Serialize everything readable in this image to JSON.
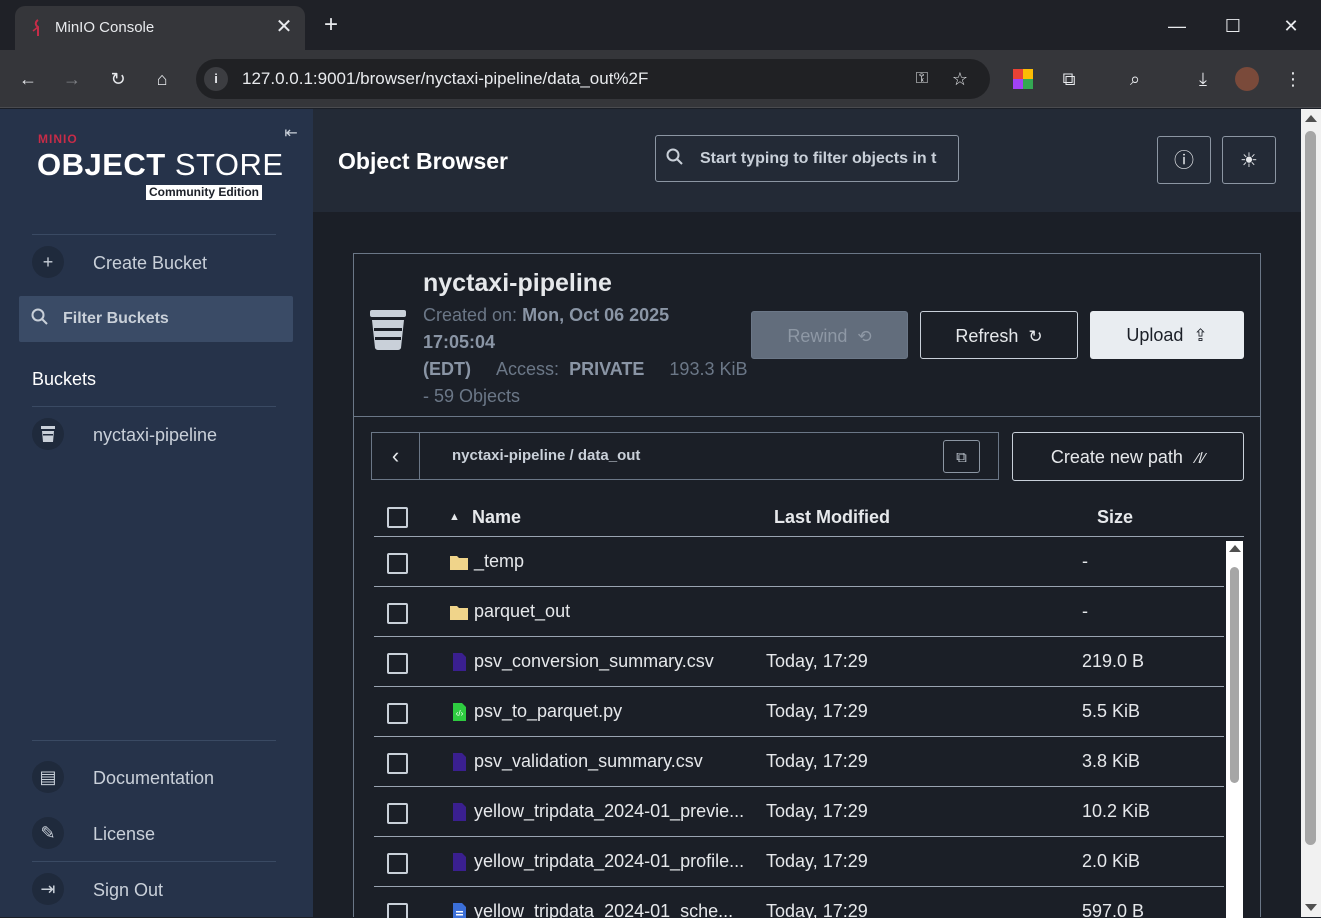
{
  "browser": {
    "tab_title": "MinIO Console",
    "url": "127.0.0.1:9001/browser/nyctaxi-pipeline/data_out%2F"
  },
  "sidebar": {
    "logo_brand": "MINIO",
    "logo_product_bold": "OBJECT",
    "logo_product_light": " STORE",
    "logo_edition": "Community Edition",
    "create_bucket": "Create Bucket",
    "filter_buckets": "Filter Buckets",
    "section_title": "Buckets",
    "buckets": [
      "nyctaxi-pipeline"
    ],
    "bottom": {
      "documentation": "Documentation",
      "license": "License",
      "sign_out": "Sign Out"
    }
  },
  "header": {
    "title": "Object Browser",
    "search_placeholder": "Start typing to filter objects in t"
  },
  "bucket": {
    "name": "nyctaxi-pipeline",
    "created_label": "Created on:",
    "created_value": "Mon, Oct 06 2025",
    "created_time": "17:05:04",
    "timezone": "(EDT)",
    "access_label": "Access:",
    "access_value": "PRIVATE",
    "size": "193.3 KiB",
    "objects": "- 59 Objects"
  },
  "actions": {
    "rewind": "Rewind",
    "refresh": "Refresh",
    "upload": "Upload",
    "create_path": "Create new path"
  },
  "breadcrumb": {
    "bucket": "nyctaxi-pipeline",
    "separator": "/",
    "folder": "data_out"
  },
  "table": {
    "columns": {
      "name": "Name",
      "modified": "Last Modified",
      "size": "Size"
    },
    "rows": [
      {
        "type": "folder",
        "name": "_temp",
        "modified": "",
        "size": "-"
      },
      {
        "type": "folder",
        "name": "parquet_out",
        "modified": "",
        "size": "-"
      },
      {
        "type": "csv",
        "name": "psv_conversion_summary.csv",
        "modified": "Today, 17:29",
        "size": "219.0 B"
      },
      {
        "type": "py",
        "name": "psv_to_parquet.py",
        "modified": "Today, 17:29",
        "size": "5.5 KiB"
      },
      {
        "type": "csv",
        "name": "psv_validation_summary.csv",
        "modified": "Today, 17:29",
        "size": "3.8 KiB"
      },
      {
        "type": "csv",
        "name": "yellow_tripdata_2024-01_previe...",
        "modified": "Today, 17:29",
        "size": "10.2 KiB"
      },
      {
        "type": "csv",
        "name": "yellow_tripdata_2024-01_profile...",
        "modified": "Today, 17:29",
        "size": "2.0 KiB"
      },
      {
        "type": "doc",
        "name": "yellow_tripdata_2024-01_sche...",
        "modified": "Today, 17:29",
        "size": "597.0 B"
      }
    ]
  },
  "colors": {
    "sidebar_bg": "#26334a",
    "accent_brand": "#c72c48",
    "folder_icon": "#f0d48a",
    "csv_icon": "#3a1f8f",
    "py_icon": "#2ecc40",
    "doc_icon": "#3b6fd8"
  }
}
